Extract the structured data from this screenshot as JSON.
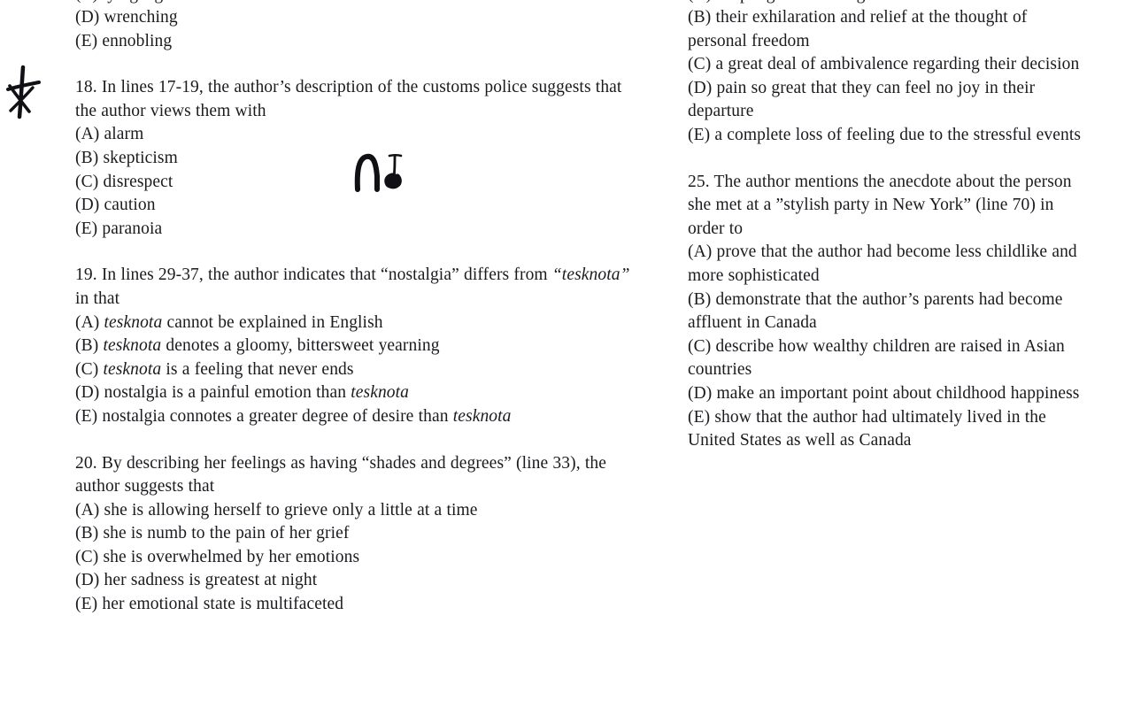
{
  "page": {
    "background_color": "#ffffff",
    "text_color": "#1b1b1f",
    "type": "scanned-test-worksheet",
    "columns": 2
  },
  "left_column": {
    "cropped_top_line": "(C) tying a glove",
    "blocks": [
      {
        "id": "q17-tail",
        "kind": "choices-continuation",
        "lines": [
          "(D) wrenching",
          "(E) ennobling"
        ]
      },
      {
        "id": "q18",
        "kind": "question",
        "number": "18.",
        "stem_lines": [
          "18. In lines 17-19, the author’s description of the customs police suggests that",
          "the author views them with"
        ],
        "choices": [
          "(A) alarm",
          "(B) skepticism",
          "(C) disrespect",
          "(D) caution",
          "(E) paranoia"
        ]
      },
      {
        "id": "q19",
        "kind": "question",
        "number": "19.",
        "stem_parts": [
          {
            "text": "19. In lines 29-37, the author indicates that “nostalgia” differs from ",
            "italic": false
          },
          {
            "text": "“tesknota”",
            "italic": true
          }
        ],
        "stem_line2": "in that",
        "choice_parts": [
          [
            {
              "text": "(A) ",
              "italic": false
            },
            {
              "text": "tesknota",
              "italic": true
            },
            {
              "text": " cannot be explained in English",
              "italic": false
            }
          ],
          [
            {
              "text": "(B) ",
              "italic": false
            },
            {
              "text": "tesknota",
              "italic": true
            },
            {
              "text": " denotes a gloomy, bittersweet yearning",
              "italic": false
            }
          ],
          [
            {
              "text": "(C) ",
              "italic": false
            },
            {
              "text": "tesknota",
              "italic": true
            },
            {
              "text": " is a feeling that never ends",
              "italic": false
            }
          ],
          [
            {
              "text": "(D) nostalgia is a painful emotion than ",
              "italic": false
            },
            {
              "text": "tesknota",
              "italic": true
            }
          ],
          [
            {
              "text": "(E) nostalgia connotes a greater degree of desire than ",
              "italic": false
            },
            {
              "text": "tesknota",
              "italic": true
            }
          ]
        ]
      },
      {
        "id": "q20",
        "kind": "question",
        "number": "20.",
        "stem_lines": [
          "20. By describing her feelings as having “shades and degrees” (line 33), the",
          "author suggests that"
        ],
        "choices": [
          "(A) she is allowing herself to grieve only a little at a time",
          "(B) she is numb to the pain of her grief",
          "(C) she is overwhelmed by her emotions",
          "(D) her sadness is greatest at night",
          "(E) her emotional state is multifaceted"
        ]
      }
    ]
  },
  "right_column": {
    "cropped_top_line": "(A) deep regret at leaving their homeland",
    "blocks": [
      {
        "id": "q24-tail",
        "kind": "choices-continuation",
        "lines": [
          "(B) their exhilaration and relief at the thought of",
          "personal freedom",
          "(C) a great deal of ambivalence regarding their decision",
          "(D) pain so great that they can feel no joy in their",
          "departure",
          "(E) a complete loss of feeling due to the stressful events"
        ]
      },
      {
        "id": "q25",
        "kind": "question",
        "number": "25.",
        "stem_lines": [
          "25. The author mentions the anecdote about the person",
          "she met at a ”stylish party in New York” (line 70) in",
          "order to"
        ],
        "choices": [
          "(A) prove that the author had become less childlike and",
          "more sophisticated",
          "(B) demonstrate that the author’s parents had become",
          "affluent in Canada",
          "(C) describe how wealthy children are raised in Asian",
          "countries",
          "(D) make an important point about childhood happiness",
          "(E) show that the author had ultimately lived in the",
          "United States as well as Canada"
        ]
      }
    ]
  },
  "annotations": [
    {
      "id": "star-mark",
      "name": "handwritten-star-mark",
      "description": "hand-drawn star / asterisk in left margin",
      "color": "#111115"
    },
    {
      "id": "squiggle-mark",
      "name": "handwritten-squiggle-mark",
      "description": "hand-drawn pen squiggle resembling an n with a flourish",
      "color": "#111115"
    }
  ]
}
